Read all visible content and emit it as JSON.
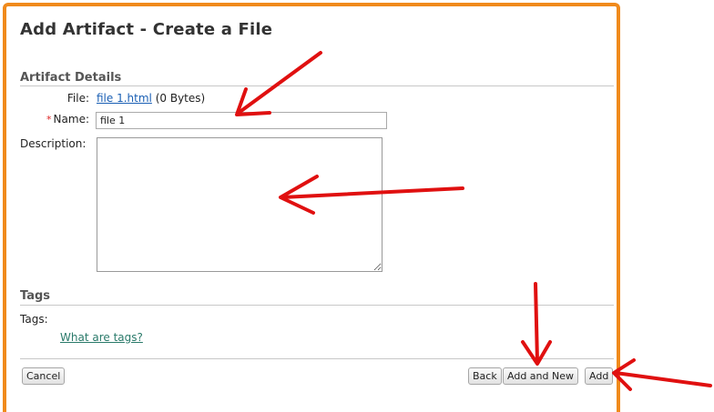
{
  "page": {
    "title": "Add Artifact - Create a File"
  },
  "artifact_details": {
    "heading": "Artifact Details",
    "file_label": "File:",
    "file_name": "file 1.html",
    "file_size": "(0 Bytes)",
    "required_marker": "*",
    "name_label": "Name:",
    "name_value": "file 1",
    "description_label": "Description:",
    "description_value": ""
  },
  "tags_section": {
    "heading": "Tags",
    "tags_label": "Tags:",
    "help_link": "What are tags?"
  },
  "buttons": {
    "cancel": "Cancel",
    "back": "Back",
    "add_and_new": "Add and New",
    "add": "Add"
  },
  "colors": {
    "frame_border": "#f08a1c",
    "annotation_arrow": "#e01010",
    "file_link": "#1a5fb4",
    "tags_link": "#2a7a6a"
  }
}
